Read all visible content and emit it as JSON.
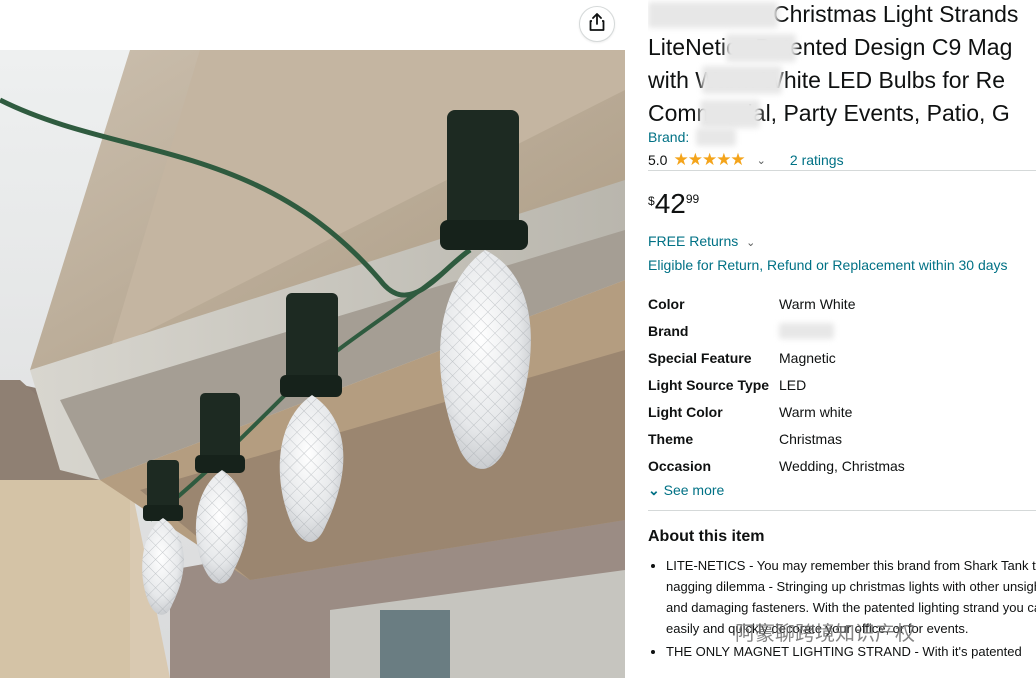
{
  "share": {
    "icon": "share-icon"
  },
  "product": {
    "title_lines": [
      "Christmas Light Strands",
      "LiteNetics Patented Design C9 Mag",
      "with Warm White LED Bulbs for Re",
      "Commercial, Party Events, Patio, G"
    ],
    "brand_label": "Brand:",
    "rating_value": "5.0",
    "stars": "★★★★★",
    "ratings_text": "2 ratings",
    "price_symbol": "$",
    "price_whole": "42",
    "price_fraction": "99",
    "free_returns": "FREE Returns",
    "eligible_text": "Eligible for Return, Refund or Replacement within 30 days"
  },
  "specs": [
    {
      "key": "Color",
      "value": "Warm White"
    },
    {
      "key": "Brand",
      "value": ""
    },
    {
      "key": "Special Feature",
      "value": "Magnetic"
    },
    {
      "key": "Light Source Type",
      "value": "LED"
    },
    {
      "key": "Light Color",
      "value": "Warm white"
    },
    {
      "key": "Theme",
      "value": "Christmas"
    },
    {
      "key": "Occasion",
      "value": "Wedding, Christmas"
    }
  ],
  "see_more": "See more",
  "about": {
    "heading": "About this item",
    "bullets": [
      "LITE-NETICS - You may remember this brand from Shark Tank to a nagging dilemma - Stringing up christmas lights with other unsightly and damaging fasteners. With the patented lighting strand you can easily and quickly decorate your office, or for events.",
      "THE ONLY MAGNET LIGHTING STRAND - With it's patented"
    ]
  },
  "watermark": "阿豪聊跨境知识产权",
  "colors": {
    "link": "#007185",
    "star": "#f4a41b",
    "text": "#0f1111"
  }
}
